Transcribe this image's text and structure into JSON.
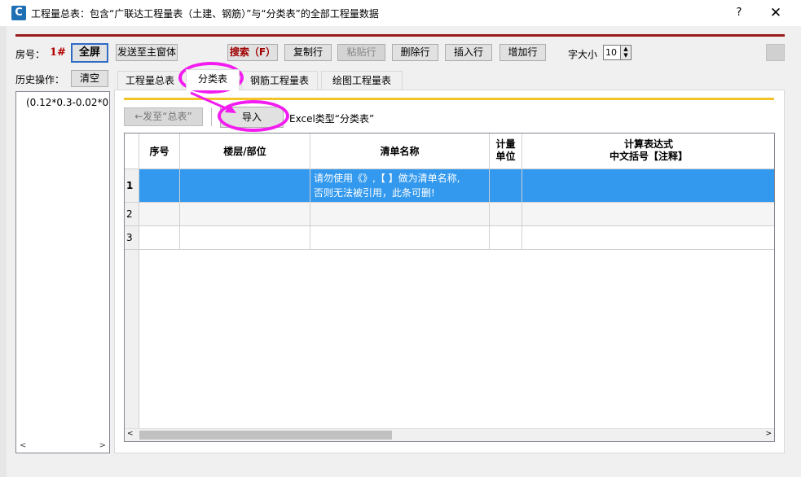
{
  "window": {
    "title": "工程量总表：包含“广联达工程量表（土建、钢筋）”与“分类表”的全部工程量数据",
    "help": "?",
    "close": "✕",
    "app_icon": "C"
  },
  "toolbar": {
    "room_label": "房号：",
    "room_number": "1#",
    "fullscreen": "全屏",
    "send_to_main": "发送至主窗体",
    "search": "搜索（F）",
    "copy_row": "复制行",
    "paste_row": "粘贴行",
    "delete_row": "删除行",
    "insert_row": "插入行",
    "add_row": "增加行",
    "font_size_label": "字大小",
    "font_size_value": "10"
  },
  "history": {
    "label": "历史操作：",
    "clear": "清空",
    "items": [
      "(0.12*0.3-0.02*0"
    ]
  },
  "tabs": [
    {
      "label": "工程量总表",
      "active": false
    },
    {
      "label": "分类表",
      "active": true
    },
    {
      "label": "钢筋工程量表",
      "active": false
    },
    {
      "label": "绘图工程量表",
      "active": false
    }
  ],
  "panel": {
    "send_total": "←发至“总表”",
    "import": "导入",
    "excel_type": "Excel类型“分类表”"
  },
  "grid": {
    "headers": {
      "seq": "序号",
      "floor": "楼层/部位",
      "name": "清单名称",
      "unit_1": "计量",
      "unit_2": "单位",
      "expr_1": "计算表达式",
      "expr_2": "中文括号【注释】"
    },
    "rows": [
      {
        "num": "1",
        "name_1": "请勿使用《》,【 】做为清单名称,",
        "name_2": "否则无法被引用，此条可删!"
      },
      {
        "num": "2"
      },
      {
        "num": "3"
      }
    ]
  },
  "colors": {
    "accent_red": "#9b1c1c",
    "selection": "#3399ee",
    "annotation": "#f31cf0",
    "yellow_rule": "#f3c42a"
  }
}
